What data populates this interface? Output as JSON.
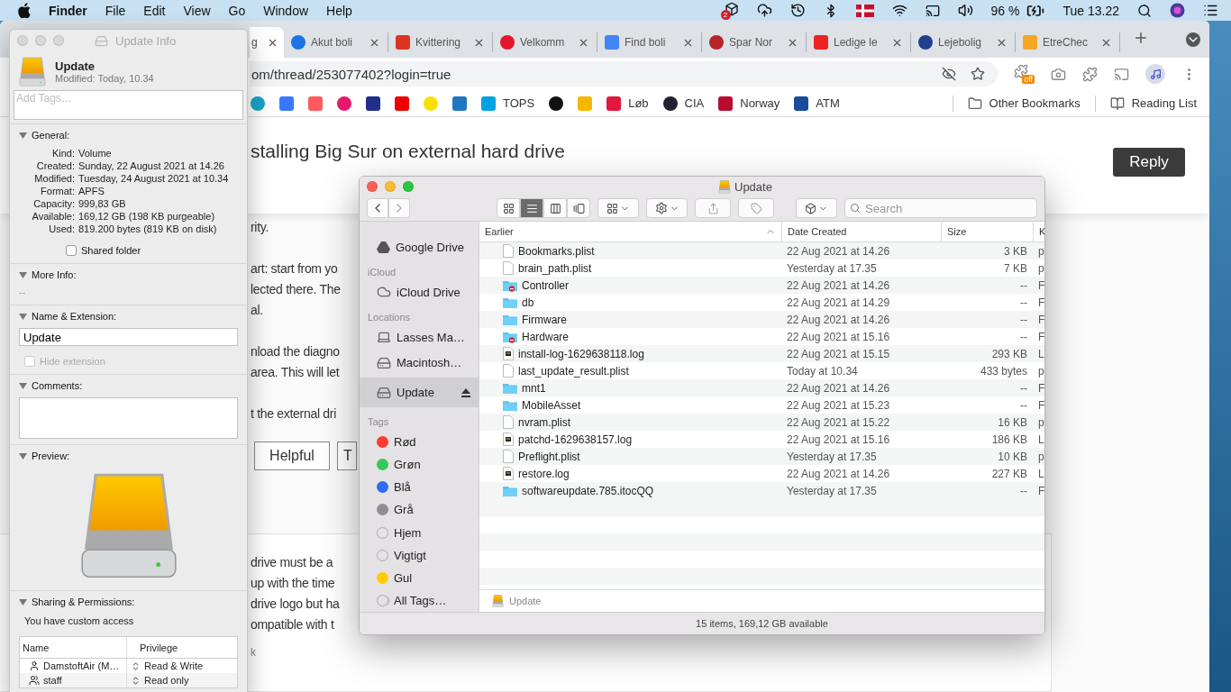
{
  "menubar": {
    "app": "Finder",
    "menus": [
      "File",
      "Edit",
      "View",
      "Go",
      "Window",
      "Help"
    ],
    "dropbox_badge": "2",
    "battery": "96 %",
    "clock": "Tue 13.22"
  },
  "browser": {
    "tabs": [
      {
        "title": "g",
        "selected": true
      },
      {
        "title": "Akut boli",
        "selected": false
      },
      {
        "title": "Kvittering",
        "selected": false
      },
      {
        "title": "Velkomm",
        "selected": false
      },
      {
        "title": "Find boli",
        "selected": false
      },
      {
        "title": "Spar Nor",
        "selected": false
      },
      {
        "title": "Ledige le",
        "selected": false
      },
      {
        "title": "Lejebolig",
        "selected": false
      },
      {
        "title": "EtreChec",
        "selected": false
      }
    ],
    "url": "om/thread/253077402?login=true",
    "extension_badge": "off",
    "bookmarks": [
      {
        "kind": "icon"
      },
      {
        "kind": "icon"
      },
      {
        "kind": "icon"
      },
      {
        "kind": "icon"
      },
      {
        "kind": "icon"
      },
      {
        "kind": "icon"
      },
      {
        "kind": "icon"
      },
      {
        "kind": "icon"
      },
      {
        "kind": "labeled",
        "label": "TOPS"
      },
      {
        "kind": "icon"
      },
      {
        "kind": "icon"
      },
      {
        "kind": "labeled",
        "label": "Løb"
      },
      {
        "kind": "labeled",
        "label": "CIA"
      },
      {
        "kind": "labeled",
        "label": "Norway"
      },
      {
        "kind": "labeled",
        "label": "ATM"
      }
    ],
    "bookmark_folders": [
      "Other Bookmarks",
      "Reading List"
    ],
    "page": {
      "heading": "stalling Big Sur on external hard drive",
      "reply": "Reply",
      "paragraphs": [
        [
          "rity."
        ],
        [
          "art: start from yo",
          "lected there. The",
          "al."
        ],
        [
          "nload the diagno",
          "area. This will let"
        ],
        [
          "t the external dri"
        ]
      ],
      "buttons": [
        "Helpful",
        "T"
      ],
      "answer_lines": [
        "drive must be a",
        "up with the time",
        "drive logo but ha",
        "ompatible with t"
      ],
      "footer": "k"
    }
  },
  "info": {
    "title": "Update Info",
    "name": "Update",
    "modified": "Modified: Today, 10.34",
    "tags_placeholder": "Add Tags…",
    "general": {
      "heading": "General:",
      "expanded": true,
      "rows": [
        {
          "label": "Kind:",
          "value": "Volume"
        },
        {
          "label": "Created:",
          "value": "Sunday, 22 August 2021 at 14.26"
        },
        {
          "label": "Modified:",
          "value": "Tuesday, 24 August 2021 at 10.34"
        },
        {
          "label": "Format:",
          "value": "APFS"
        },
        {
          "label": "Capacity:",
          "value": "999,83 GB"
        },
        {
          "label": "Available:",
          "value": "169,12 GB (198 KB purgeable)"
        },
        {
          "label": "Used:",
          "value": "819.200 bytes (819 KB on disk)"
        }
      ],
      "shared_folder": {
        "label": "Shared folder",
        "checked": false
      }
    },
    "more_info": {
      "heading": "More Info:",
      "expanded": true,
      "value": "--"
    },
    "name_extension": {
      "heading": "Name & Extension:",
      "expanded": true,
      "value": "Update",
      "hide_extension": {
        "label": "Hide extension",
        "checked": false,
        "disabled": true
      }
    },
    "comments": {
      "heading": "Comments:",
      "expanded": true
    },
    "preview": {
      "heading": "Preview:",
      "expanded": true
    },
    "sharing": {
      "heading": "Sharing & Permissions:",
      "expanded": true,
      "note": "You have custom access",
      "columns": [
        "Name",
        "Privilege"
      ],
      "rows": [
        {
          "name": "DamstoftAir (M…",
          "kind": "user",
          "privilege": "Read & Write"
        },
        {
          "name": "staff",
          "kind": "group",
          "privilege": "Read only"
        }
      ]
    }
  },
  "finder": {
    "title": "Update",
    "search_placeholder": "Search",
    "views": [
      {
        "kind": "icons",
        "selected": false
      },
      {
        "kind": "list",
        "selected": true
      },
      {
        "kind": "columns",
        "selected": false
      },
      {
        "kind": "gallery",
        "selected": false
      }
    ],
    "sidebar": [
      {
        "items": [
          {
            "label": "Google Drive",
            "kind": "gdrive",
            "selected": false
          }
        ]
      },
      {
        "heading": "iCloud",
        "items": [
          {
            "label": "iCloud Drive",
            "kind": "cloud",
            "selected": false
          }
        ]
      },
      {
        "heading": "Locations",
        "items": [
          {
            "label": "Lasses Ma…",
            "kind": "laptop",
            "selected": false
          },
          {
            "label": "Macintosh…",
            "kind": "disk",
            "selected": false
          },
          {
            "label": "Update",
            "kind": "drive",
            "selected": true,
            "eject": true
          }
        ]
      }
    ],
    "tags_heading": "Tags",
    "tags": [
      {
        "label": "Rød",
        "kind": "color",
        "color": "#ff3b30"
      },
      {
        "label": "Grøn",
        "kind": "color",
        "color": "#34c759"
      },
      {
        "label": "Blå",
        "kind": "color",
        "color": "#2f6cf6"
      },
      {
        "label": "Grå",
        "kind": "color",
        "color": "#8e8e93"
      },
      {
        "label": "Hjem",
        "kind": "empty"
      },
      {
        "label": "Vigtigt",
        "kind": "empty"
      },
      {
        "label": "Gul",
        "kind": "color",
        "color": "#ffcc00"
      },
      {
        "label": "All Tags…",
        "kind": "all"
      }
    ],
    "columns": [
      {
        "label": "Earlier",
        "sorted": true
      },
      {
        "label": "Date Created",
        "sorted": false
      },
      {
        "label": "Size",
        "sorted": false
      },
      {
        "label": "K",
        "sorted": false
      }
    ],
    "files": [
      {
        "name": "Bookmarks.plist",
        "kind": "file",
        "date": "22 Aug 2021 at 14.26",
        "size": "3 KB",
        "column_4": "p"
      },
      {
        "name": "brain_path.plist",
        "kind": "file",
        "date": "Yesterday at 17.35",
        "size": "7 KB",
        "column_4": "p"
      },
      {
        "name": "Controller",
        "kind": "folder_locked",
        "date": "22 Aug 2021 at 14.26",
        "size": "--",
        "column_4": "F"
      },
      {
        "name": "db",
        "kind": "folder",
        "date": "22 Aug 2021 at 14.29",
        "size": "--",
        "column_4": "F"
      },
      {
        "name": "Firmware",
        "kind": "folder",
        "date": "22 Aug 2021 at 14.26",
        "size": "--",
        "column_4": "F"
      },
      {
        "name": "Hardware",
        "kind": "folder_locked",
        "date": "22 Aug 2021 at 15.16",
        "size": "--",
        "column_4": "F"
      },
      {
        "name": "install-log-1629638118.log",
        "kind": "log",
        "date": "22 Aug 2021 at 15.15",
        "size": "293 KB",
        "column_4": "L"
      },
      {
        "name": "last_update_result.plist",
        "kind": "file",
        "date": "Today at 10.34",
        "size": "433 bytes",
        "column_4": "p"
      },
      {
        "name": "mnt1",
        "kind": "folder",
        "date": "22 Aug 2021 at 14.26",
        "size": "--",
        "column_4": "F"
      },
      {
        "name": "MobileAsset",
        "kind": "folder",
        "date": "22 Aug 2021 at 15.23",
        "size": "--",
        "column_4": "F"
      },
      {
        "name": "nvram.plist",
        "kind": "file",
        "date": "22 Aug 2021 at 15.22",
        "size": "16 KB",
        "column_4": "p"
      },
      {
        "name": "patchd-1629638157.log",
        "kind": "log",
        "date": "22 Aug 2021 at 15.16",
        "size": "186 KB",
        "column_4": "L"
      },
      {
        "name": "Preflight.plist",
        "kind": "file",
        "date": "Yesterday at 17.35",
        "size": "10 KB",
        "column_4": "p"
      },
      {
        "name": "restore.log",
        "kind": "log",
        "date": "22 Aug 2021 at 14.26",
        "size": "227 KB",
        "column_4": "L"
      },
      {
        "name": "softwareupdate.785.itocQQ",
        "kind": "folder",
        "date": "Yesterday at 17.35",
        "size": "--",
        "column_4": "F"
      }
    ],
    "path": "Update",
    "status": "15 items, 169,12 GB available"
  }
}
